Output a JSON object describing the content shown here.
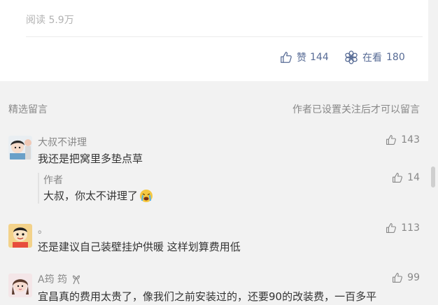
{
  "article": {
    "read_label": "阅读 5.9万",
    "like_label": "赞",
    "like_count": "144",
    "look_label": "在看",
    "look_count": "180"
  },
  "comments_section": {
    "title": "精选留言",
    "notice": "作者已设置关注后才可以留言"
  },
  "comments": [
    {
      "nickname": "大叔不讲理",
      "content": "我还是把窝里多垫点草",
      "likes": "143",
      "reply": {
        "nickname": "作者",
        "content": "大叔，你太不讲理了",
        "likes": "14"
      }
    },
    {
      "nickname": "。",
      "content": "还是建议自己装壁挂炉供暖 这样划算费用低",
      "likes": "113"
    },
    {
      "nickname": "A筠 筠",
      "content": "宜昌真的费用太贵了，像我们之前安装过的，还要90的改装费，一百多平",
      "likes": "99"
    }
  ]
}
